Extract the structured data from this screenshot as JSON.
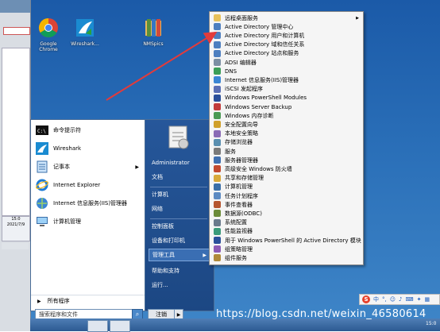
{
  "desktop": {
    "icons": [
      {
        "label": "Google\nChrome",
        "icon": "chrome-icon"
      },
      {
        "label": "Wireshark...",
        "icon": "wireshark-icon"
      },
      {
        "label": "NMSpics",
        "icon": "folder-icon"
      }
    ]
  },
  "left_window": {
    "thumb_time": "15:0",
    "thumb_date": "2021/7/9"
  },
  "start_menu": {
    "left_items": [
      {
        "label": "命令提示符",
        "icon": "cmd-icon"
      },
      {
        "label": "Wireshark",
        "icon": "wireshark-icon"
      },
      {
        "label": "记事本",
        "icon": "notepad-icon",
        "has_submenu": true
      },
      {
        "label": "Internet Explorer",
        "icon": "ie-icon"
      },
      {
        "label": "Internet 信息服务(IIS)管理器",
        "icon": "iis-icon"
      },
      {
        "label": "计算机管理",
        "icon": "computer-management-icon"
      }
    ],
    "all_programs": "所有程序",
    "search_placeholder": "搜索程序和文件",
    "right_items": [
      {
        "label": "Administrator"
      },
      {
        "label": "文档"
      },
      {
        "label": "计算机"
      },
      {
        "label": "网络"
      },
      {
        "label": "控制面板"
      },
      {
        "label": "设备和打印机"
      },
      {
        "label": "管理工具",
        "active": true,
        "has_submenu": true
      },
      {
        "label": "帮助和支持"
      },
      {
        "label": "运行..."
      }
    ],
    "shutdown_label": "注销"
  },
  "admin_tools": [
    {
      "label": "远程桌面服务",
      "icon": "folder-icon",
      "has_submenu": true
    },
    {
      "label": "Active Directory 管理中心",
      "icon": "ad-icon"
    },
    {
      "label": "Active Directory 用户和计算机",
      "icon": "ad-icon"
    },
    {
      "label": "Active Directory 域和信任关系",
      "icon": "ad-icon"
    },
    {
      "label": "Active Directory 站点和服务",
      "icon": "ad-icon"
    },
    {
      "label": "ADSI 编辑器",
      "icon": "adsi-icon"
    },
    {
      "label": "DNS",
      "icon": "dns-icon"
    },
    {
      "label": "Internet 信息服务(IIS)管理器",
      "icon": "iis-icon"
    },
    {
      "label": "iSCSI 发起程序",
      "icon": "iscsi-icon"
    },
    {
      "label": "Windows PowerShell Modules",
      "icon": "powershell-icon"
    },
    {
      "label": "Windows Server Backup",
      "icon": "backup-icon"
    },
    {
      "label": "Windows 内存诊断",
      "icon": "memory-icon"
    },
    {
      "label": "安全配置向导",
      "icon": "security-icon"
    },
    {
      "label": "本地安全策略",
      "icon": "policy-icon"
    },
    {
      "label": "存储浏览器",
      "icon": "storage-icon"
    },
    {
      "label": "服务",
      "icon": "services-icon"
    },
    {
      "label": "服务器管理器",
      "icon": "server-icon"
    },
    {
      "label": "高级安全 Windows 防火墙",
      "icon": "firewall-icon"
    },
    {
      "label": "共享和存储管理",
      "icon": "share-icon"
    },
    {
      "label": "计算机管理",
      "icon": "computer-management-icon"
    },
    {
      "label": "任务计划程序",
      "icon": "task-icon"
    },
    {
      "label": "事件查看器",
      "icon": "event-icon"
    },
    {
      "label": "数据源(ODBC)",
      "icon": "odbc-icon"
    },
    {
      "label": "系统配置",
      "icon": "config-icon"
    },
    {
      "label": "性能监视器",
      "icon": "perf-icon"
    },
    {
      "label": "用于 Windows PowerShell 的 Active Directory 模块",
      "icon": "powershell-icon"
    },
    {
      "label": "组策略管理",
      "icon": "gpo-icon"
    },
    {
      "label": "组件服务",
      "icon": "component-icon"
    }
  ],
  "ime_bar": {
    "logo": "S",
    "items": [
      "中",
      "°,",
      "☺",
      "♪",
      "⌨",
      "✦",
      "▦"
    ]
  },
  "watermark": "https://blog.csdn.net/weixin_46580614",
  "clock": "15:0",
  "colors": {
    "desktop": "#2a6fb8",
    "start_right": "#1c4783",
    "arrow": "#e23b3b",
    "menu_bg": "#f5f5f5"
  }
}
